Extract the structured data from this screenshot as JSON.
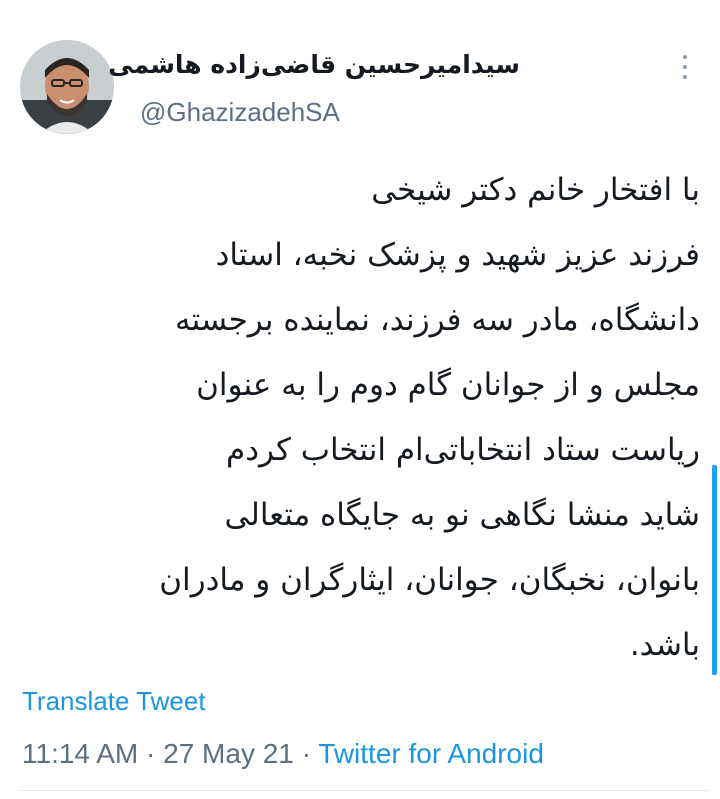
{
  "author": {
    "display_name": "سیدامیرحسین قاضی‌زاده هاشمی",
    "handle": "@GhazizadehSA",
    "avatar_icon": "profile-photo"
  },
  "more_icon": "more-vertical-icon",
  "body_lines": [
    "با افتخار خانم دکتر شیخی",
    "فرزند عزیز شهید و پزشک نخبه، استاد",
    "دانشگاه، مادر سه فرزند، نماینده برجسته",
    "مجلس و از جوانان گام دوم را به عنوان",
    "ریاست ستاد انتخاباتی‌ام انتخاب کردم",
    "شاید منشا نگاهی نو به جایگاه متعالی",
    "بانوان، نخبگان، جوانان، ایثارگران و مادران",
    "باشد."
  ],
  "translate_label": "Translate Tweet",
  "meta": {
    "time": "11:14 AM",
    "separator": "·",
    "date": "27 May 21",
    "source": "Twitter for Android"
  },
  "colors": {
    "link": "#1b95e0",
    "secondary_text": "#5b7083",
    "primary_text": "#141a1f"
  }
}
